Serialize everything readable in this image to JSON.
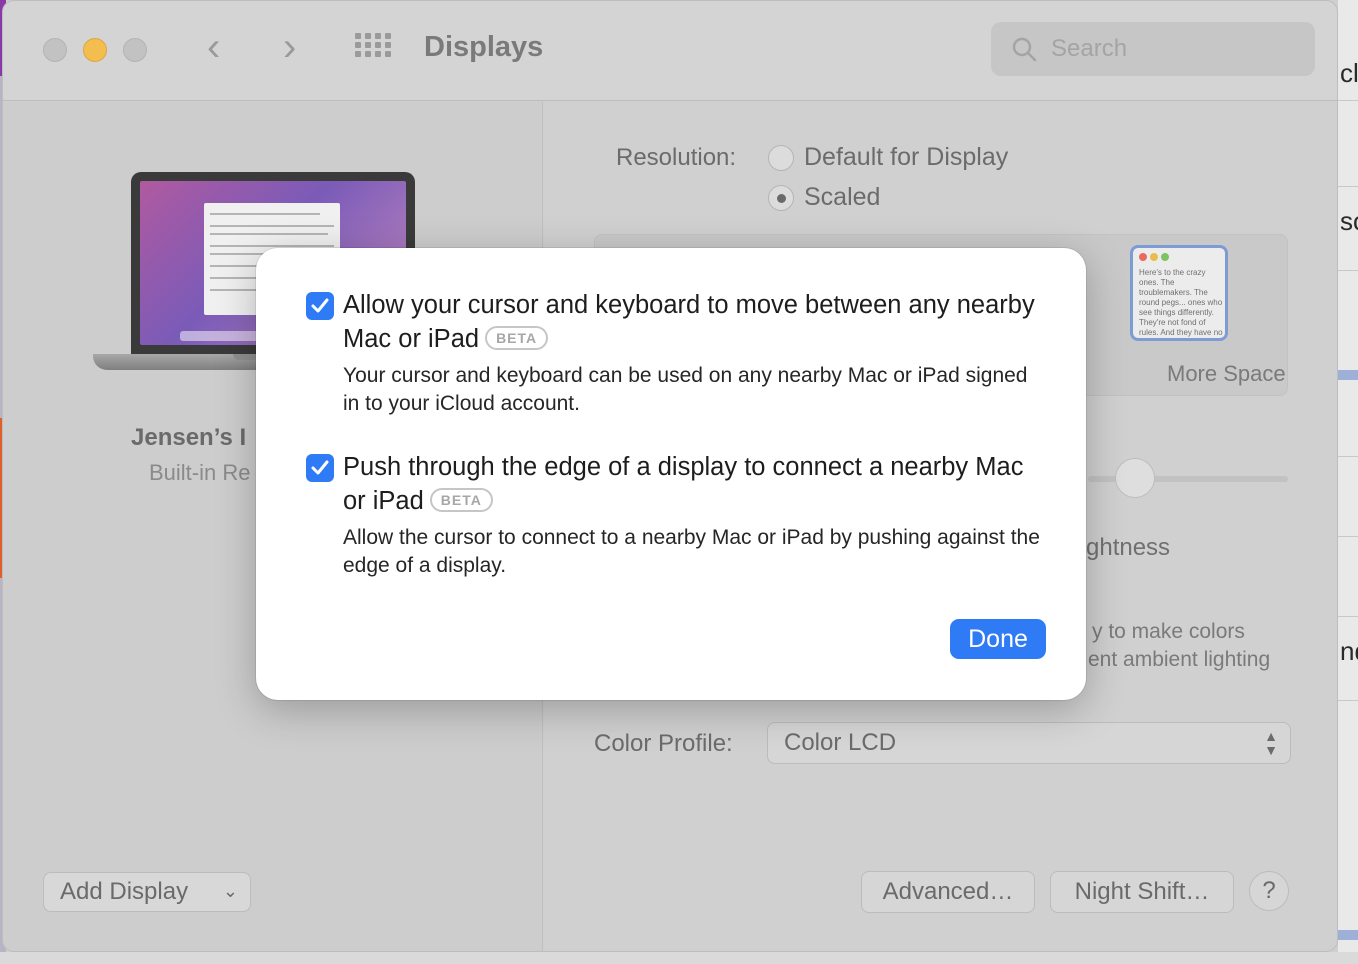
{
  "window": {
    "title": "Displays",
    "search_placeholder": "Search"
  },
  "sidebar": {
    "display_name": "Jensen’s I",
    "display_subtitle": "Built-in Re",
    "add_display_label": "Add Display"
  },
  "settings": {
    "resolution_label": "Resolution:",
    "resolution_options": [
      "Default for Display",
      "Scaled"
    ],
    "resolution_selected": "Scaled",
    "scale_option_label": "More Space",
    "thumbnail_text": "Here's to the crazy ones. The troublemakers. The round pegs... ones who see things differently. They're not fond of rules. And they have no respect... You can quote them, disagree with them. About the only thing... Because they change things.",
    "partial_brightness_label": "ghtness",
    "partial_truetone_line1": "y to make colors",
    "partial_truetone_line2": "ent ambient lighting",
    "color_profile_label": "Color Profile:",
    "color_profile_value": "Color LCD",
    "advanced_button": "Advanced…",
    "night_shift_button": "Night Shift…",
    "help_button": "?"
  },
  "modal": {
    "options": [
      {
        "title": "Allow your cursor and keyboard to move between any nearby Mac or iPad",
        "badge": "BETA",
        "description": "Your cursor and keyboard can be used on any nearby Mac or iPad signed in to your iCloud account.",
        "checked": true
      },
      {
        "title": "Push through the edge of a display to connect a nearby Mac or iPad",
        "badge": "BETA",
        "description": "Allow the cursor to connect to a nearby Mac or iPad by pushing against the edge of a display.",
        "checked": true
      }
    ],
    "done_label": "Done"
  },
  "background_window": {
    "snippets": [
      "cl",
      "so",
      "nd"
    ]
  },
  "colors": {
    "accent": "#2f7bf5",
    "close": "#c2c2c2",
    "minimize": "#f3bd4f",
    "zoom": "#c2c2c2"
  }
}
